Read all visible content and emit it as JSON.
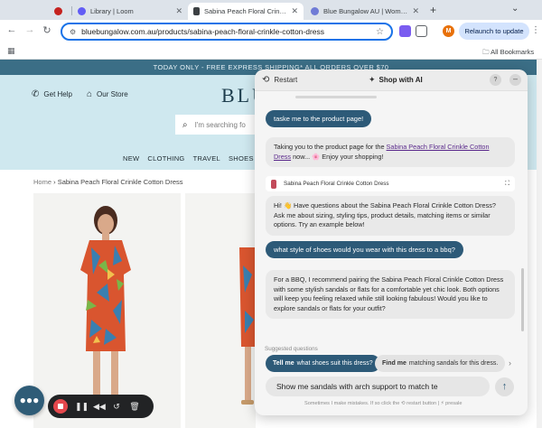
{
  "browser": {
    "tabs": [
      {
        "title": "",
        "favicon_color": "#c5221f",
        "active": false
      },
      {
        "title": "Library | Loom",
        "favicon_color": "#625df5",
        "active": false
      },
      {
        "title": "Sabina Peach Floral Crinkle C",
        "favicon_color": "#3c4043",
        "active": true
      },
      {
        "title": "Blue Bungalow AU | Women's",
        "favicon_color": "#6f7bd6",
        "active": false
      }
    ],
    "new_tab": "+",
    "url": "bluebungalow.com.au/products/sabina-peach-floral-crinkle-cotton-dress",
    "profile_initial": "M",
    "relaunch_label": "Relaunch to update",
    "all_bookmarks": "All Bookmarks"
  },
  "site": {
    "promo": "TODAY ONLY - FREE EXPRESS SHIPPING* ALL ORDERS OVER $70",
    "get_help": "Get Help",
    "our_store": "Our Store",
    "logo": "BLUE",
    "search_placeholder": "I'm searching fo",
    "nav": [
      "NEW",
      "CLOTHING",
      "TRAVEL",
      "SHOES"
    ],
    "breadcrumb_home": "Home",
    "breadcrumb_sep": "›",
    "breadcrumb_current": "Sabina Peach Floral Crinkle Cotton Dress"
  },
  "assistant": {
    "restart": "Restart",
    "title": "Shop with AI",
    "help": "?",
    "messages": {
      "user1": "taske me to the product page!",
      "bot1_prefix": "Taking you to the product page for the ",
      "bot1_link": "Sabina Peach Floral Crinkle Cotton Dress",
      "bot1_suffix": " now... 🌸 Enjoy your shopping!",
      "product_card": "Sabina Peach Floral Crinkle Cotton Dress",
      "bot2": "Hi! 👋 Have questions about the Sabina Peach Floral Crinkle Cotton Dress? Ask me about sizing, styling tips, product details, matching items or similar options. Try an example below!",
      "user2": "what style of shoes would you wear with this dress to a bbq?",
      "bot3": "For a BBQ, I recommend pairing the Sabina Peach Floral Crinkle Cotton Dress with some stylish sandals or flats for a comfortable yet chic look. Both options will keep you feeling relaxed while still looking fabulous! Would you like to explore sandals or flats for your outfit?"
    },
    "suggested_label": "Suggested questions",
    "suggestions": [
      {
        "bold": "Tell me",
        "rest": "what shoes suit this dress?"
      },
      {
        "bold": "Find me",
        "rest": "matching sandals for this dress."
      }
    ],
    "input_value": "Show me sandals with arch support to match te",
    "disclaimer": "Sometimes I make mistakes. If so click the ⟲ restart button  |  ⚡ presale"
  },
  "colors": {
    "accent": "#2d5a78",
    "header_bg": "#cfe8ef",
    "promo_bg": "#3b6e86",
    "record": "#e5484d"
  }
}
